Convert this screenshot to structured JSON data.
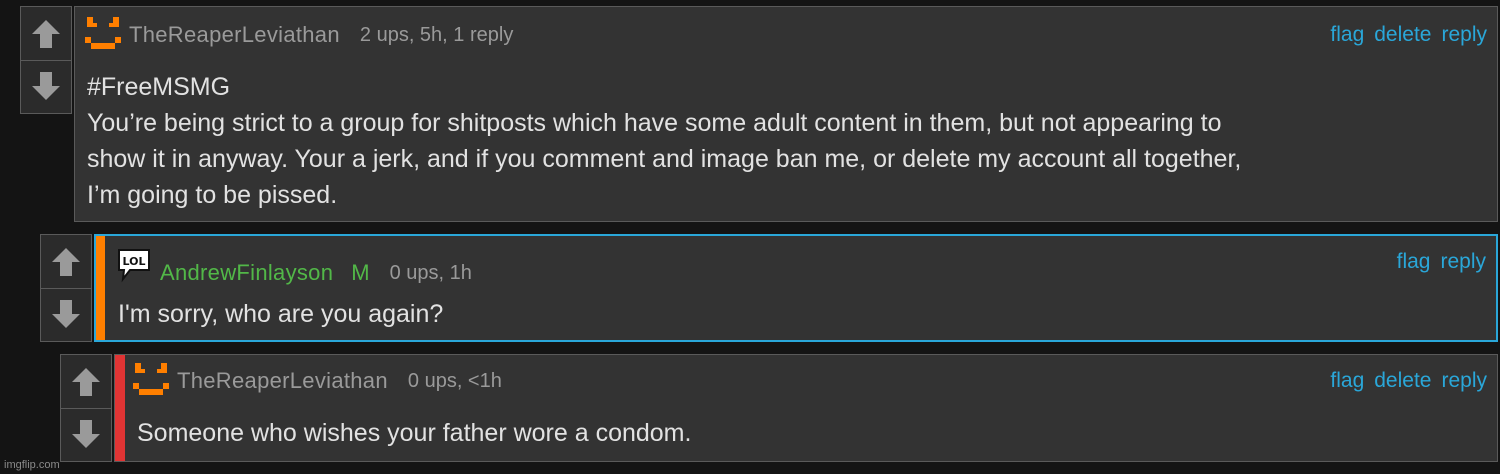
{
  "comments": [
    {
      "username": "TheReaperLeviathan",
      "meta": "2 ups, 5h, 1 reply",
      "actions": [
        "flag",
        "delete",
        "reply"
      ],
      "lines": [
        "#FreeMSMG",
        "You’re being strict to a group for shitposts which have some adult content in them, but not appearing to",
        "show it in anyway. Your a jerk, and if you comment and image ban me, or delete my account all together,",
        "I’m going to be pissed."
      ]
    },
    {
      "username": "AndrewFinlayson",
      "badge": "M",
      "meta": "0 ups, 1h",
      "actions": [
        "flag",
        "reply"
      ],
      "lines": [
        "I'm sorry, who are you again?"
      ]
    },
    {
      "username": "TheReaperLeviathan",
      "meta": "0 ups, <1h",
      "actions": [
        "flag",
        "delete",
        "reply"
      ],
      "lines": [
        "Someone who wishes your father wore a condom."
      ]
    }
  ],
  "avatar_lol_text": "LOL",
  "watermark": "imgflip.com",
  "colors": {
    "link": "#2aa7d9",
    "mod_green": "#52b848",
    "orange": "#ff7f00",
    "red": "#e03434",
    "panel": "#333333"
  }
}
